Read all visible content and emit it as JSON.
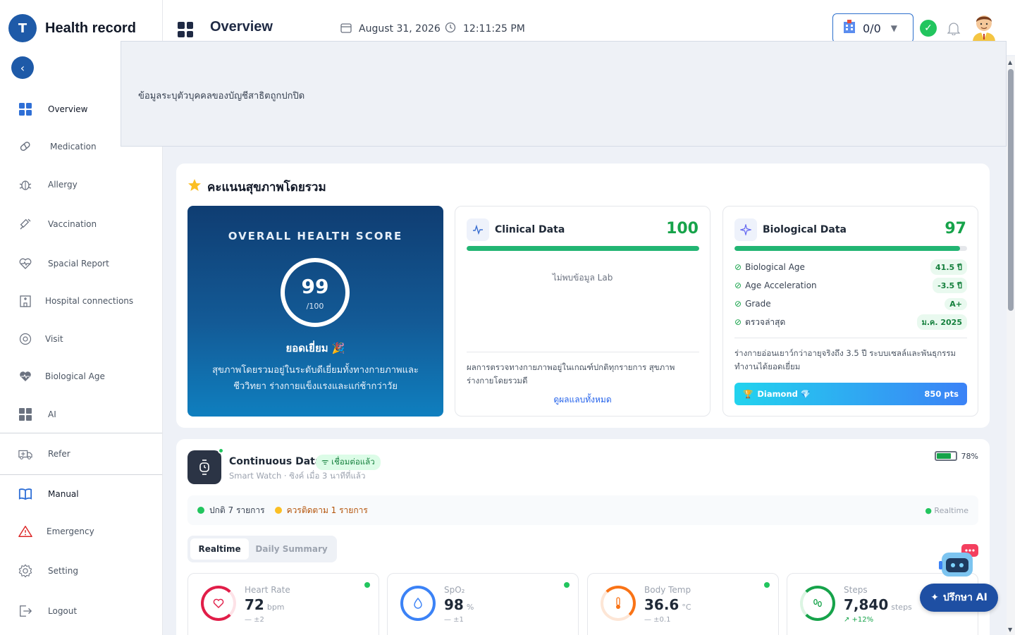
{
  "app": {
    "title": "Health record",
    "logo_text": "T"
  },
  "header": {
    "title": "Overview",
    "date": "August 31, 2026",
    "time": "12:11:25 PM",
    "hospital_count": "0/0"
  },
  "dropdown": {
    "message": "ข้อมูลระบุตัวบุคคลของบัญชีสาธิตถูกปกปิด"
  },
  "sidebar": {
    "items": [
      {
        "label": "Overview",
        "icon": "grid-icon"
      },
      {
        "label": "Medication",
        "icon": "pill-icon"
      },
      {
        "label": "Allergy",
        "icon": "bug-icon"
      },
      {
        "label": "Vaccination",
        "icon": "syringe-icon"
      },
      {
        "label": "Spacial Report",
        "icon": "heart-pulse-icon"
      },
      {
        "label": "Hospital connections",
        "icon": "hospital-icon"
      },
      {
        "label": "Visit",
        "icon": "target-icon"
      },
      {
        "label": "Biological Age",
        "icon": "heart-icon"
      },
      {
        "label": "AI",
        "icon": "grid-icon"
      },
      {
        "label": "Refer",
        "icon": "ambulance-icon"
      },
      {
        "label": "Manual",
        "icon": "book-icon"
      },
      {
        "label": "Emergency",
        "icon": "warning-icon"
      },
      {
        "label": "Setting",
        "icon": "gear-icon"
      },
      {
        "label": "Logout",
        "icon": "logout-icon"
      }
    ]
  },
  "health": {
    "section_title": "คะแนนสุขภาพโดยรวม",
    "overall": {
      "title": "OVERALL HEALTH SCORE",
      "score": "99",
      "max": "/100",
      "grade": "ยอดเยี่ยม 🎉",
      "description": "สุขภาพโดยรวมอยู่ในระดับดีเยี่ยมทั้งทางกายภาพและชีววิทยา ร่างกายแข็งแรงและแก่ช้ากว่าวัย"
    },
    "clinical": {
      "title": "Clinical Data",
      "score": "100",
      "progress": 1.0,
      "no_data": "ไม่พบข้อมูล Lab",
      "note": "ผลการตรวจทางกายภาพอยู่ในเกณฑ์ปกติทุกรายการ สุขภาพร่างกายโดยรวมดี",
      "link": "ดูผลแลบทั้งหมด"
    },
    "biological": {
      "title": "Biological Data",
      "score": "97",
      "progress": 0.97,
      "rows": [
        {
          "label": "Biological Age",
          "value": "41.5 ปี"
        },
        {
          "label": "Age Acceleration",
          "value": "-3.5 ปี"
        },
        {
          "label": "Grade",
          "value": "A+"
        },
        {
          "label": "ตรวจล่าสุด",
          "value": "ม.ค. 2025"
        }
      ],
      "note": "ร่างกายอ่อนเยาว์กว่าอายุจริงถึง 3.5 ปี ระบบเซลล์และพันธุกรรมทำงานได้ยอดเยี่ยม",
      "tier": "Diamond 💎",
      "points": "850 pts"
    }
  },
  "continuous": {
    "title": "Continuous Data",
    "badge": "ᯤ เชื่อมต่อแล้ว",
    "subtitle": "Smart Watch · ซิงค์ เมื่อ 3 นาทีที่แล้ว",
    "battery": "78%",
    "battery_level": 0.78,
    "normal": "ปกติ 7 รายการ",
    "warning": "ควรติดตาม 1 รายการ",
    "mode": "Realtime",
    "tabs": [
      "Realtime",
      "Daily Summary"
    ],
    "metrics": [
      {
        "name": "Heart Rate",
        "value": "72",
        "unit": "bpm",
        "delta": "— ±2",
        "color": "#e11d48",
        "icon": "heart-icon"
      },
      {
        "name": "SpO₂",
        "value": "98",
        "unit": "%",
        "delta": "— ±1",
        "color": "#3b82f6",
        "icon": "droplet-icon"
      },
      {
        "name": "Body Temp",
        "value": "36.6",
        "unit": "°C",
        "delta": "— ±0.1",
        "color": "#f97316",
        "icon": "thermometer-icon"
      },
      {
        "name": "Steps",
        "value": "7,840",
        "unit": "steps",
        "delta": "↗ +12%",
        "color": "#16a34a",
        "icon": "footsteps-icon"
      }
    ]
  },
  "ai_button": {
    "label": "ปรึกษา AI"
  },
  "colors": {
    "brand": "#1e5aa8",
    "success": "#22b573",
    "warning": "#f59e0b"
  }
}
